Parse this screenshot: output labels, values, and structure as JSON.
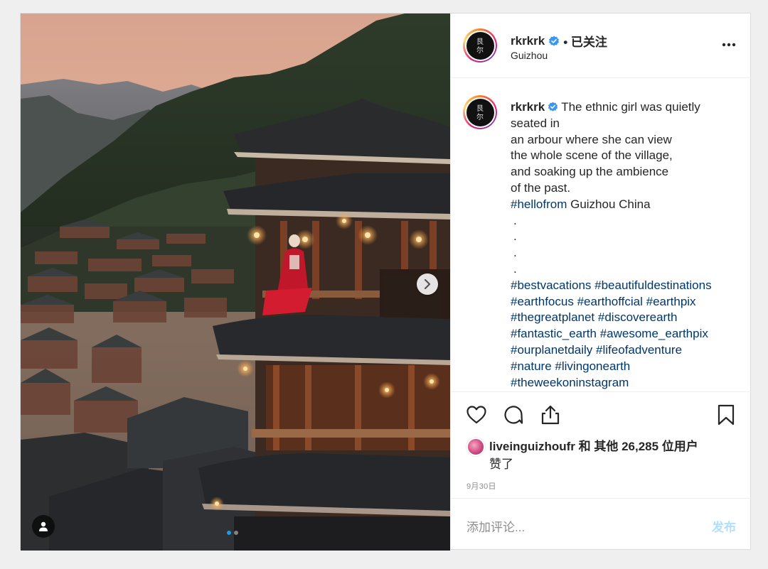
{
  "post": {
    "username": "rkrkrk",
    "follow_status": "• 已关注",
    "location": "Guizhou",
    "avatar_text": "艮 尔"
  },
  "caption": {
    "username": "rkrkrk",
    "lines": [
      "The ethnic girl was quietly seated in",
      "an arbour where she can view",
      "the whole scene of the village,",
      "and soaking up the ambience",
      "of the past."
    ],
    "hello_tag": "#hellofrom",
    "hello_rest": " Guizhou China",
    "dots": [
      ".",
      ".",
      ".",
      "."
    ],
    "hashtags": [
      [
        "#bestvacations",
        "#beautifuldestinations"
      ],
      [
        "#earthfocus",
        "#earthoffcial",
        "#earthpix"
      ],
      [
        "#thegreatplanet",
        "#discoverearth"
      ],
      [
        "#fantastic_earth",
        "#awesome_earthpix"
      ],
      [
        "#ourplanetdaily",
        "#lifeofadventure"
      ],
      [
        "#nature",
        "#livingonearth"
      ],
      [
        "#theweekoninstagram"
      ]
    ]
  },
  "likes": {
    "user": "liveinguizhoufr",
    "connector": " 和 ",
    "others": "其他 26,285 位用户",
    "suffix": "赞了"
  },
  "date": "9月30日",
  "comment": {
    "placeholder": "添加评论...",
    "post_label": "发布"
  },
  "carousel": {
    "total": 2,
    "current": 1
  },
  "colors": {
    "link": "#00376b",
    "verified": "#3897f0",
    "post_disabled": "#b2dffc",
    "sky": "#e8b59a"
  },
  "icons": [
    "verified-badge-icon",
    "more-options-icon",
    "heart-icon",
    "comment-icon",
    "share-icon",
    "bookmark-icon",
    "next-arrow-icon",
    "user-tag-icon"
  ]
}
